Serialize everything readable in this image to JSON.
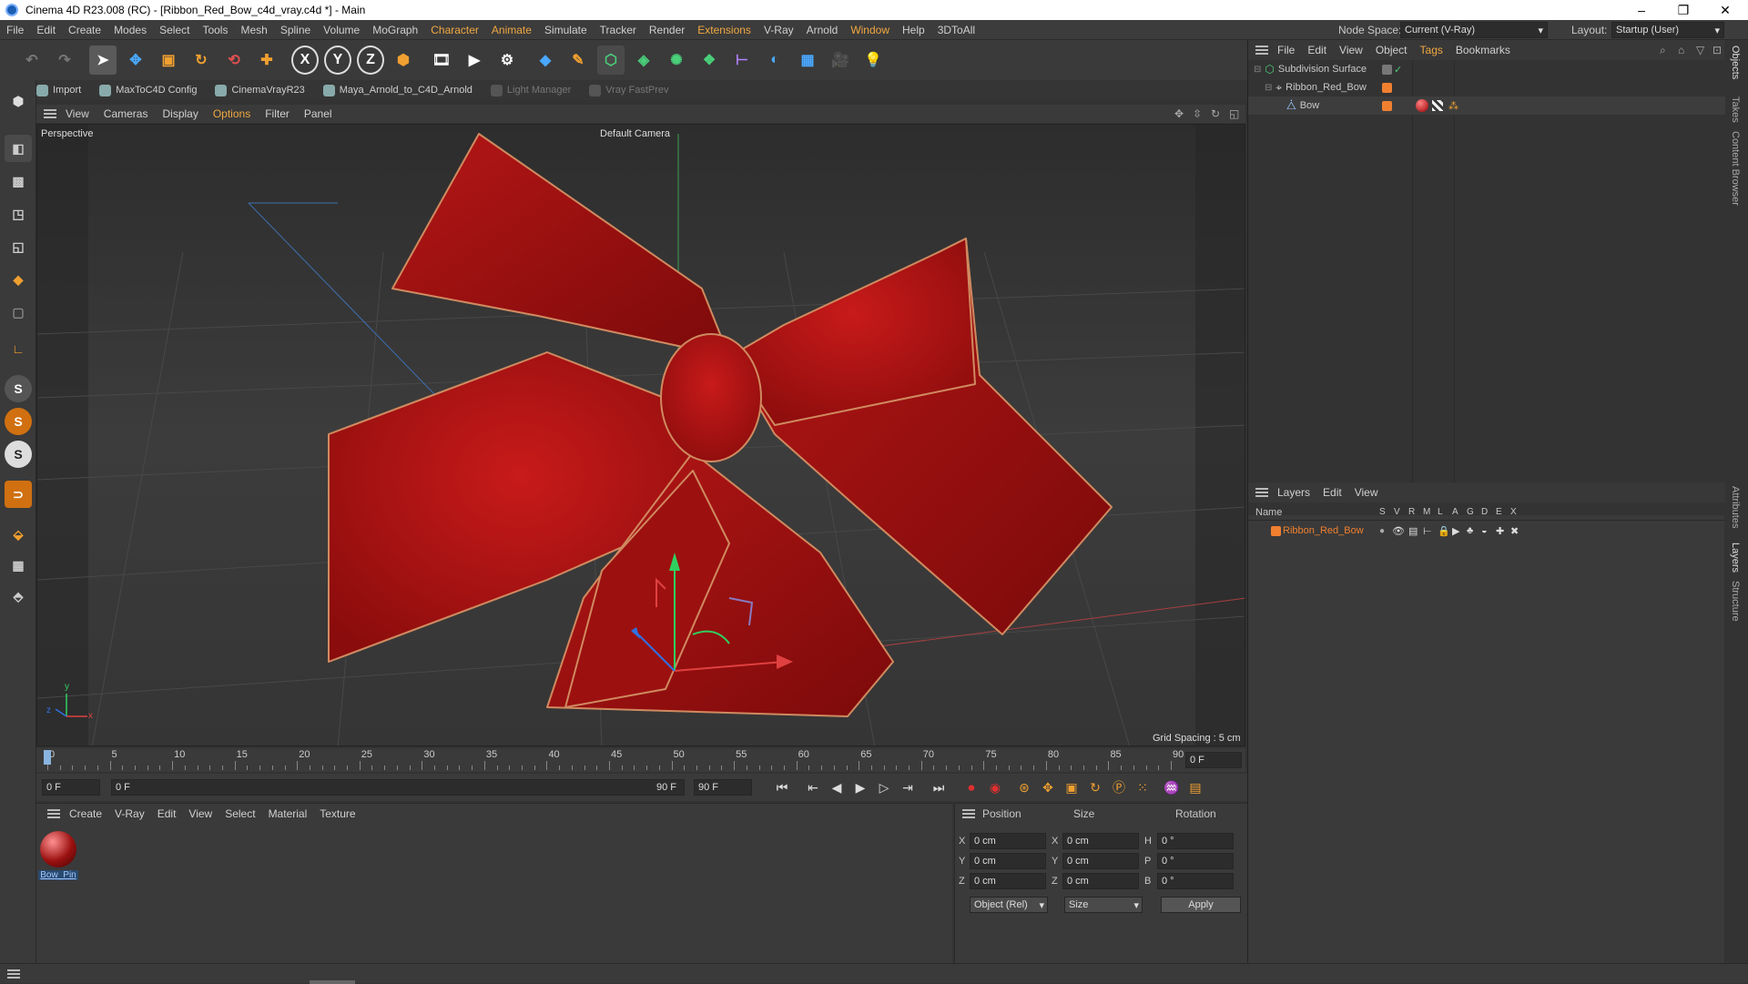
{
  "window": {
    "title": "Cinema 4D R23.008 (RC) - [Ribbon_Red_Bow_c4d_vray.c4d *] - Main",
    "minimize": "–",
    "restore": "❐",
    "close": "✕"
  },
  "menu": {
    "items": [
      "File",
      "Edit",
      "Create",
      "Modes",
      "Select",
      "Tools",
      "Mesh",
      "Spline",
      "Volume",
      "MoGraph",
      "Character",
      "Animate",
      "Simulate",
      "Tracker",
      "Render",
      "Extensions",
      "V-Ray",
      "Arnold",
      "Window",
      "Help",
      "3DToAll"
    ],
    "node_space_label": "Node Space:",
    "node_space_value": "Current (V-Ray)",
    "layout_label": "Layout:",
    "layout_value": "Startup (User)"
  },
  "plugins": [
    "Import",
    "MaxToC4D Config",
    "CinemaVrayR23",
    "Maya_Arnold_to_C4D_Arnold",
    "Light Manager",
    "Vray FastPrev"
  ],
  "viewport": {
    "menu": [
      "View",
      "Cameras",
      "Display",
      "Options",
      "Filter",
      "Panel"
    ],
    "projection": "Perspective",
    "camera": "Default Camera",
    "grid_spacing": "Grid Spacing : 5 cm",
    "accent": "#f0a840",
    "axis_y": "y",
    "axis_x": "x",
    "axis_z": "z"
  },
  "timeline": {
    "ticks": [
      "0",
      "5",
      "10",
      "15",
      "20",
      "25",
      "30",
      "35",
      "40",
      "45",
      "50",
      "55",
      "60",
      "65",
      "70",
      "75",
      "80",
      "85",
      "90"
    ],
    "current_frame_field": "0 F",
    "start_field": "0 F",
    "range_start": "0 F",
    "range_end": "90 F",
    "end_field": "90 F"
  },
  "material_manager": {
    "menu": [
      "Create",
      "V-Ray",
      "Edit",
      "View",
      "Select",
      "Material",
      "Texture"
    ],
    "materials": [
      {
        "name": "Bow_Pin"
      }
    ]
  },
  "attributes": {
    "headers": [
      "Position",
      "Size",
      "Rotation"
    ],
    "rows": [
      {
        "axis": "X",
        "pos": "0 cm",
        "size_axis": "X",
        "size": "0 cm",
        "rot_axis": "H",
        "rot": "0 °"
      },
      {
        "axis": "Y",
        "pos": "0 cm",
        "size_axis": "Y",
        "size": "0 cm",
        "rot_axis": "P",
        "rot": "0 °"
      },
      {
        "axis": "Z",
        "pos": "0 cm",
        "size_axis": "Z",
        "size": "0 cm",
        "rot_axis": "B",
        "rot": "0 °"
      }
    ],
    "coord_mode": "Object (Rel)",
    "size_mode": "Size",
    "apply": "Apply"
  },
  "object_manager": {
    "menu": [
      "File",
      "Edit",
      "View",
      "Object",
      "Tags",
      "Bookmarks"
    ],
    "objects": [
      {
        "name": "Subdivision Surface",
        "color": "#f0e040"
      },
      {
        "name": "Ribbon_Red_Bow",
        "color": "#f08030"
      },
      {
        "name": "Bow",
        "color": "#f08030"
      }
    ]
  },
  "layer_manager": {
    "menu": [
      "Layers",
      "Edit",
      "View"
    ],
    "columns": [
      "Name",
      "S",
      "V",
      "R",
      "M",
      "L",
      "A",
      "G",
      "D",
      "E",
      "X"
    ],
    "layers": [
      {
        "name": "Ribbon_Red_Bow",
        "color": "#f08030"
      }
    ]
  },
  "side_tabs": [
    "Objects",
    "Takes",
    "Content Browser",
    "Attributes",
    "Layers",
    "Structure"
  ]
}
